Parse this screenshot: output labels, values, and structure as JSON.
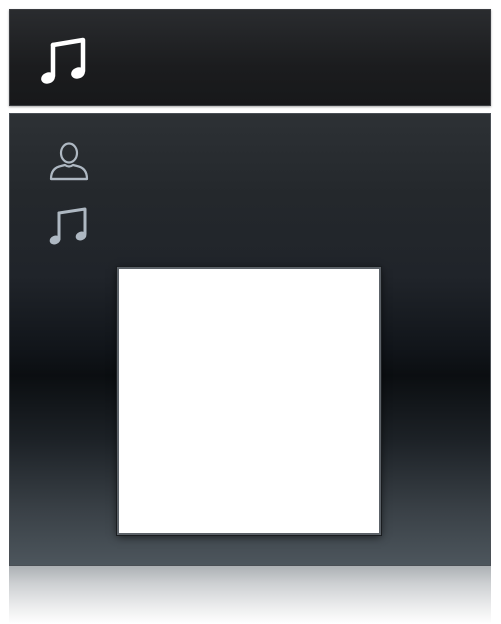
{
  "header": {
    "icon": "music-note-icon",
    "title": ""
  },
  "panel": {
    "nav_items": [
      {
        "icon": "person-icon",
        "label": ""
      },
      {
        "icon": "music-note-icon",
        "label": ""
      }
    ],
    "album_art": {
      "placeholder": "blank-white"
    }
  },
  "colors": {
    "header_bg": "#1b1c1e",
    "panel_top": "#2d3135",
    "panel_mid": "#0b0e11",
    "panel_bottom": "#4d565d",
    "icon_header": "#ffffff",
    "icon_nav": "#aeb8c2",
    "art_bg": "#ffffff"
  }
}
